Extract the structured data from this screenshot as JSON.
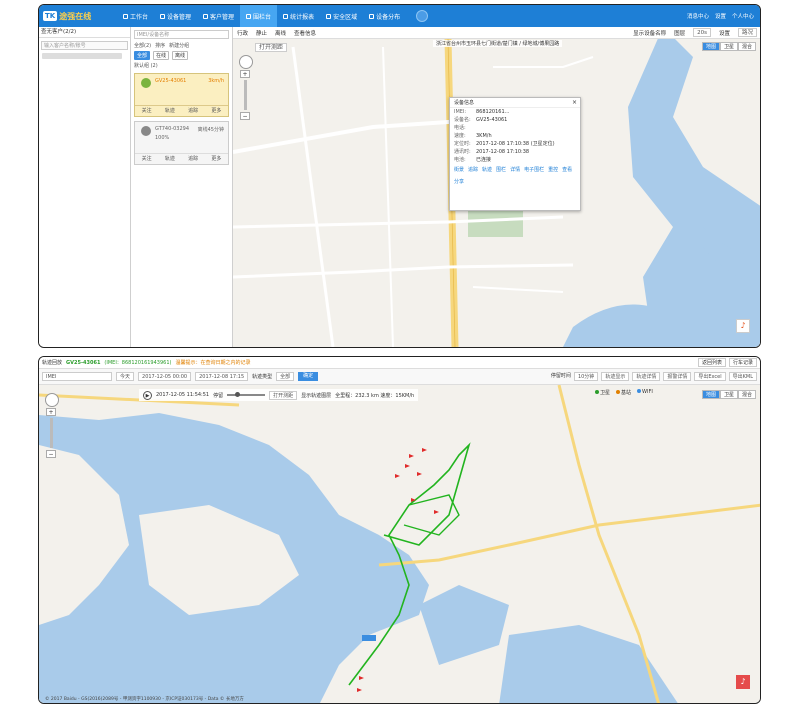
{
  "header": {
    "logo_badge": "TK",
    "logo_text": "途强在线",
    "nav": [
      "工作台",
      "设备管理",
      "客户管理",
      "围栏台",
      "统计报表",
      "安全区域",
      "设备分布"
    ],
    "right": [
      "消息中心",
      "设置",
      "个人中心"
    ]
  },
  "client_panel": {
    "title": "查无客户(2/2)",
    "search_placeholder": "输入客户名称/账号"
  },
  "device_panel": {
    "search_placeholder": "IMEI/设备名称",
    "toolbar": [
      "全部(2)",
      "排序",
      "新建分组"
    ],
    "filters": [
      "全部",
      "在线",
      "离线"
    ],
    "default_group": "默认组 (2)",
    "devices": [
      {
        "name": "GV25-43061",
        "speed": "3km/h",
        "actions": [
          "关注",
          "轨迹",
          "追踪",
          "更多"
        ]
      },
      {
        "name": "GT740-03294",
        "speed": "离线45分钟",
        "battery": "100%",
        "actions": [
          "关注",
          "轨迹",
          "追踪",
          "更多"
        ]
      }
    ]
  },
  "map1": {
    "bar": [
      "行政",
      "静止",
      "离线",
      "查看信息"
    ],
    "ranging": "打开测距",
    "address": "浙江省台州市玉环县七门街道/楚门镇 / 绿地城/傅果园路",
    "show_name": "显示设备名称",
    "interval": "20s",
    "types": [
      "地图",
      "卫星",
      "混合"
    ],
    "settings": "设置",
    "layers": "图层",
    "road_label": "路况"
  },
  "popup": {
    "title": "设备信息",
    "rows": [
      {
        "k": "IMEI:",
        "v": "868120161..."
      },
      {
        "k": "设备名:",
        "v": "GV25-43061"
      },
      {
        "k": "电话:",
        "v": ""
      },
      {
        "k": "速度:",
        "v": "3KM/h"
      },
      {
        "k": "定位时:",
        "v": "2017-12-08 17:10:38 (卫星定位)"
      },
      {
        "k": "通讯时:",
        "v": "2017-12-08 17:10:38"
      },
      {
        "k": "电池:",
        "v": "已连接"
      }
    ],
    "links": [
      "街景",
      "追踪",
      "轨迹",
      "围栏",
      "详情",
      "电子围栏",
      "重控",
      "查看",
      "分享"
    ]
  },
  "playback": {
    "title": "轨迹回放",
    "plate": "GV25-43061",
    "imei": "(IMEI：868120161943961)",
    "warn": "温馨提示：在查询日期之内的记录",
    "buttons_right": [
      "返回列表",
      "行车记录"
    ],
    "query": {
      "device": "IMEI",
      "day": "今天",
      "start": "2017-12-05 00:00",
      "end": "2017-12-08 17:15",
      "type_label": "轨迹类型",
      "type_value": "全部",
      "query_btn": "确定",
      "right": [
        "停留时间",
        "10分钟",
        "轨迹显示",
        "轨迹详情",
        "报警详情",
        "导出Excel",
        "导出KML"
      ]
    },
    "player": {
      "time": "2017-12-05 11:54:51",
      "status": "停留",
      "ranging": "打开测距",
      "follow": "显示轨迹图层",
      "distance": "全里程：232.3 km 速度：15KM/h"
    },
    "legend": [
      "卫星",
      "基站",
      "WIFI"
    ],
    "map_types": [
      "地图",
      "卫星",
      "混合"
    ],
    "footer": "© 2017 Baidu - GS(2016)2089号 - 甲测资字1100930 - 京ICP证030173号 - Data © 长地万方"
  },
  "colors": {
    "primary": "#1e7fd6",
    "track": "#22b41f",
    "water": "#a9cbea",
    "road": "#f6d77d"
  }
}
